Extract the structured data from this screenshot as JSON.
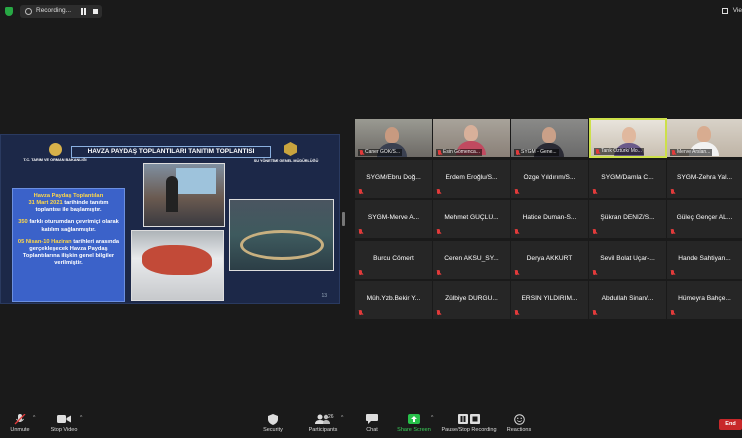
{
  "topbar": {
    "recording_label": "Recording...",
    "view_label": "Vie"
  },
  "slide": {
    "title": "HAVZA PAYDAŞ TOPLANTILARI TANITIM TOPLANTISI",
    "org_left": "T.C. TARIM VE ORMAN BAKANLIĞI",
    "org_right": "SU YÖNETİMİ GENEL MÜDÜRLÜĞÜ",
    "p1_a": "Havza Paydaş Toplantıları",
    "p1_b": "31 Mart 2021",
    "p1_c": "tarihinde tanıtım toplantısı ile başlamıştır.",
    "p2_a": "350",
    "p2_b": "farklı oturumdan çevrimiçi olarak katılım sağlanmıştır.",
    "p3_a": "05 Nisan-10 Haziran",
    "p3_b": "tarihleri arasında gerçekleşecek Havza Paydaş Toplantılarına ilişkin genel bilgiler verilmiştir.",
    "page_number": "13"
  },
  "participants": {
    "video_row": [
      "Caner GÖK/S...",
      "Esin Gömenca...",
      "SYGM - Gene...",
      "Tarık Öztürk/ Mo...",
      "Merve Arslan..."
    ],
    "rows": [
      [
        "SYGM/Ebru Doğ...",
        "Erdem Eroğlu/S...",
        "Özge Yıldırım/S...",
        "SYGM/Damla C...",
        "SYGM-Zehra Yal..."
      ],
      [
        "SYGM-Merve A...",
        "Mehmet GÜÇLÜ...",
        "Hatice Duman-S...",
        "Şükran DENİZ/S...",
        "Güleç Gençer AL..."
      ],
      [
        "Burcu Cömert",
        "Ceren AKSU_SY...",
        "Derya AKKURT",
        "Sevil Bolat Uçar-...",
        "Hande Sahtiyan..."
      ],
      [
        "Müh.Yzb.Bekir Y...",
        "Zülbiye DURGU...",
        "ERSİN YILDIRIM...",
        "Abdullah Sinan/...",
        "Hümeyra Bahçe..."
      ]
    ]
  },
  "toolbar": {
    "unmute": "Unmute",
    "stop_video": "Stop Video",
    "security": "Security",
    "participants": "Participants",
    "participant_count": "26",
    "chat": "Chat",
    "share_screen": "Share Screen",
    "pause_stop_recording": "Pause/Stop Recording",
    "reactions": "Reactions",
    "end": "End"
  },
  "colors": {
    "share_green": "#27c04a",
    "end_red": "#c8282a",
    "active_speaker": "#cde04a",
    "muted_red": "#e23b3b"
  }
}
